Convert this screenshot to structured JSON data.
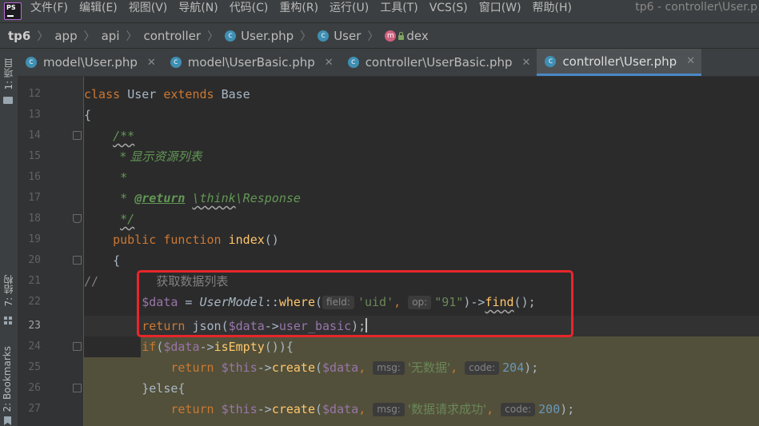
{
  "app": {
    "logo_text": "PS",
    "window_title": "tp6 - controller\\User.p",
    "menu": [
      "文件(F)",
      "编辑(E)",
      "视图(V)",
      "导航(N)",
      "代码(C)",
      "重构(R)",
      "运行(U)",
      "工具(T)",
      "VCS(S)",
      "窗口(W)",
      "帮助(H)"
    ]
  },
  "breadcrumb": {
    "project": "tp6",
    "items": [
      "app",
      "api",
      "controller"
    ],
    "file": "User.php",
    "class": "User",
    "method_icon": "m",
    "method": "dex"
  },
  "tabs": [
    {
      "label": "model\\User.php",
      "active": false
    },
    {
      "label": "model\\UserBasic.php",
      "active": false
    },
    {
      "label": "controller\\UserBasic.php",
      "active": false
    },
    {
      "label": "controller\\User.php",
      "active": true
    }
  ],
  "toolwindows": {
    "project": "1: 项目",
    "structure": "7: 结构",
    "bookmarks": "2: Bookmarks"
  },
  "colors": {
    "highlight": "#52503a",
    "annotation_box": "#e8262b",
    "active_tab": "#4a88c7"
  },
  "editor": {
    "current_line": "23",
    "lines": [
      {
        "n": "12",
        "t": {
          "kw1": "class",
          "name": "User",
          "kw2": "extends",
          "base": "Base"
        }
      },
      {
        "n": "13",
        "t": {
          "brace": "{"
        }
      },
      {
        "n": "14",
        "t": {
          "doc": "/**"
        }
      },
      {
        "n": "15",
        "t": {
          "doc": "* 显示资源列表"
        }
      },
      {
        "n": "16",
        "t": {
          "doc": "*"
        }
      },
      {
        "n": "17",
        "t": {
          "star": "*",
          "tag": "@return",
          "ret_ns": "\\think",
          "ret_rest": "\\Response"
        }
      },
      {
        "n": "18",
        "t": {
          "doc": "*/"
        }
      },
      {
        "n": "19",
        "t": {
          "kw1": "public",
          "kw2": "function",
          "name": "index",
          "paren": "()"
        }
      },
      {
        "n": "20",
        "t": {
          "brace": "{"
        }
      },
      {
        "n": "21",
        "t": {
          "cmt": "//",
          "text": "获取数据列表"
        }
      },
      {
        "n": "22",
        "t": {
          "var": "$data",
          "eq": " = ",
          "cls": "UserModel",
          "dc": "::",
          "fn": "where",
          "lp": "(",
          "h1": "field:",
          "s1": "'uid'",
          "comma": ",",
          "h2": "op:",
          "s2": "\"91\"",
          "arrow": ")->",
          "fn2": "find",
          "end": "();"
        }
      },
      {
        "n": "23",
        "t": {
          "kw": "return",
          "fn": " json(",
          "var": "$data",
          "arrow": "->",
          "prop": "user_basic",
          "end": ");"
        }
      },
      {
        "n": "24",
        "t": {
          "kw": "if",
          "lp": "(",
          "var": "$data",
          "arrow": "->",
          "fn": "isEmpty",
          "end": "()){"
        }
      },
      {
        "n": "25",
        "t": {
          "kw": "return",
          "var": "$this",
          "arrow": "->",
          "fn": "create",
          "lp": "(",
          "var2": "$data",
          "comma": ",",
          "hint": "msg:",
          "str": "'无数据'",
          "comma2": ",",
          "hint2": "code:",
          "num": "204",
          "end": ");"
        }
      },
      {
        "n": "26",
        "t": {
          "text": "}else{"
        }
      },
      {
        "n": "27",
        "t": {
          "kw": "return",
          "var": "$this",
          "arrow": "->",
          "fn": "create",
          "lp": "(",
          "var2": "$data",
          "comma": ",",
          "hint": "msg:",
          "str": "'数据请求成功'",
          "comma2": ",",
          "hint2": "code:",
          "num": "200",
          "end": ");"
        }
      }
    ]
  }
}
